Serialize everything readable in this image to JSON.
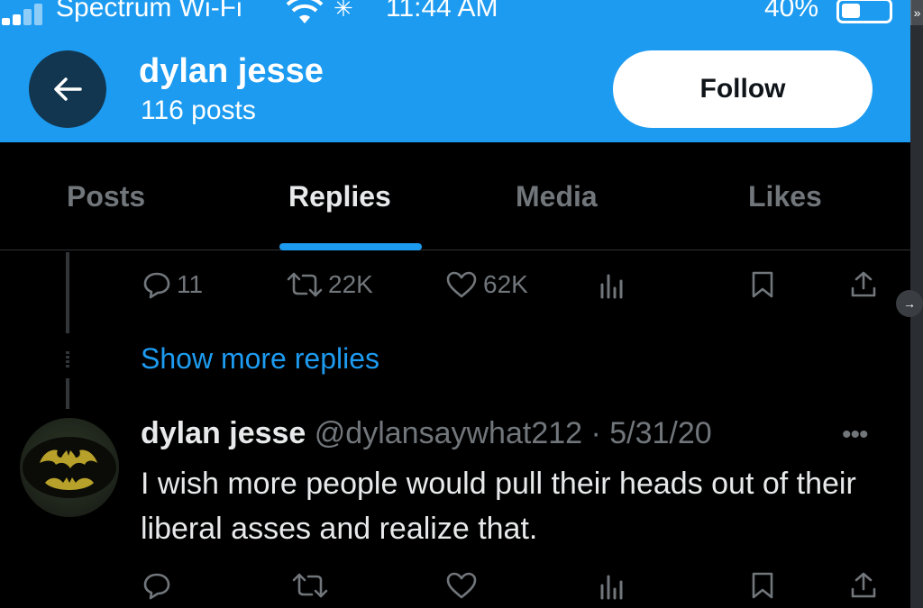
{
  "status_bar": {
    "carrier": "Spectrum Wi-Fi",
    "time": "11:44 AM",
    "battery_percent": "40%",
    "battery_level": 0.4
  },
  "header": {
    "name": "dylan jesse",
    "posts_count": "116 posts",
    "follow_label": "Follow"
  },
  "tabs": [
    {
      "label": "Posts",
      "active": false
    },
    {
      "label": "Replies",
      "active": true
    },
    {
      "label": "Media",
      "active": false
    },
    {
      "label": "Likes",
      "active": false
    }
  ],
  "previous_tweet_actions": {
    "replies": "11",
    "reposts": "22K",
    "likes": "62K"
  },
  "show_more_label": "Show more replies",
  "tweet": {
    "author": "dylan jesse",
    "handle_date": "@dylansaywhat212 · 5/31/20",
    "text": "I wish more people would pull their heads out of their liberal asses and realize that."
  },
  "colors": {
    "accent": "#1d9bf0",
    "background": "#000000",
    "muted": "#71767b",
    "text": "#e7e9ea"
  },
  "icons": [
    "back-arrow-icon",
    "reply-icon",
    "repost-icon",
    "like-icon",
    "views-icon",
    "bookmark-icon",
    "share-icon",
    "more-icon",
    "wifi-icon",
    "signal-icon",
    "battery-icon"
  ]
}
